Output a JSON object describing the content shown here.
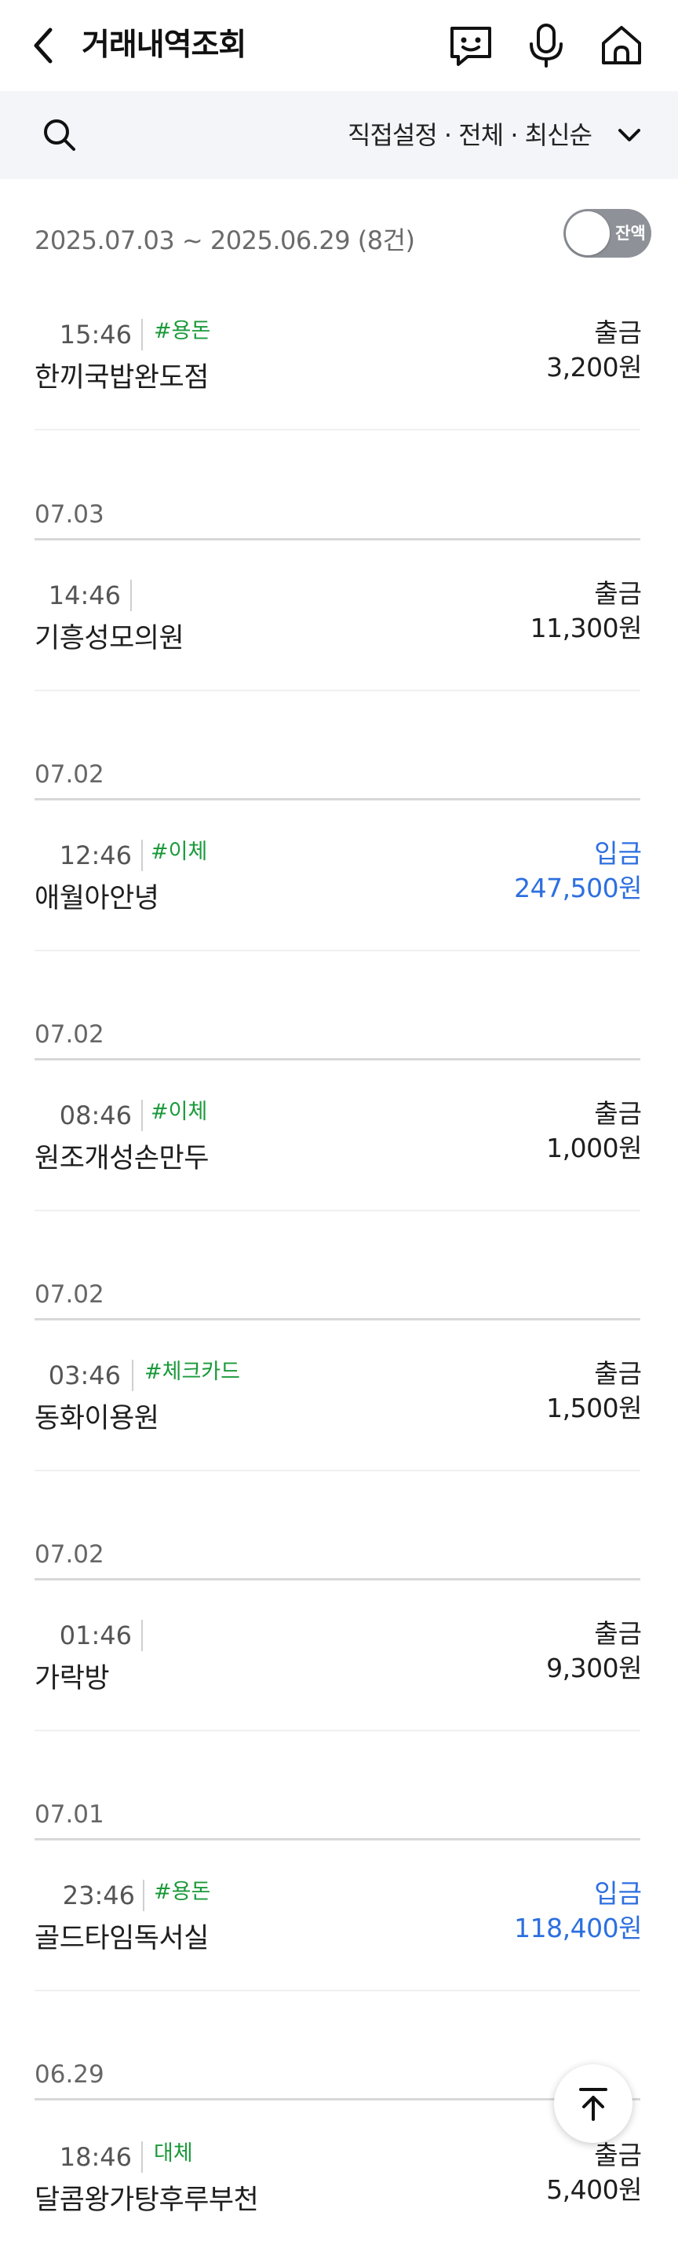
{
  "header": {
    "title": "거래내역조회",
    "icons": [
      "back-arrow-icon",
      "chatbot-icon",
      "microphone-icon",
      "home-icon"
    ]
  },
  "filter": {
    "label": "직접설정 · 전체 · 최신순"
  },
  "summary": {
    "range": "2025.07.03 ~ 2025.06.29 (8건)",
    "balance_toggle_label": "잔액",
    "balance_toggle_on": false
  },
  "transactions": [
    {
      "time": "15:46",
      "tag": "#용돈",
      "name": "한끼국밥완도점",
      "type": "출금",
      "amount": "3,200원",
      "direction": "out"
    },
    {
      "date": "07.03",
      "time": "14:46",
      "tag": "",
      "name": "기흥성모의원",
      "type": "출금",
      "amount": "11,300원",
      "direction": "out"
    },
    {
      "date": "07.02",
      "time": "12:46",
      "tag": "#이체",
      "name": "애월아안녕",
      "type": "입금",
      "amount": "247,500원",
      "direction": "in"
    },
    {
      "date": "07.02",
      "time": "08:46",
      "tag": "#이체",
      "name": "원조개성손만두",
      "type": "출금",
      "amount": "1,000원",
      "direction": "out"
    },
    {
      "date": "07.02",
      "time": "03:46",
      "tag": "#체크카드",
      "name": "동화이용원",
      "type": "출금",
      "amount": "1,500원",
      "direction": "out"
    },
    {
      "date": "07.02",
      "time": "01:46",
      "tag": "",
      "name": "가락방",
      "type": "출금",
      "amount": "9,300원",
      "direction": "out"
    },
    {
      "date": "07.01",
      "time": "23:46",
      "tag": "#용돈",
      "name": "골드타임독서실",
      "type": "입금",
      "amount": "118,400원",
      "direction": "in"
    },
    {
      "date": "06.29",
      "time": "18:46",
      "tag": "대체",
      "name": "달콤왕가탕후루부천",
      "type": "출금",
      "amount": "5,400원",
      "direction": "out"
    }
  ],
  "colors": {
    "deposit": "#2d6fe0",
    "withdrawal": "#1e1e1e",
    "tag": "#1a9a3a",
    "filter_bar_bg": "#f3f5f9"
  },
  "scroll_top_icon": "arrow-up-icon"
}
